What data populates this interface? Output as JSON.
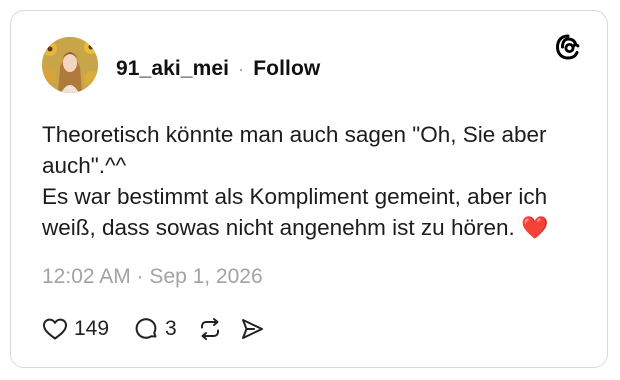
{
  "post": {
    "username": "91_aki_mei",
    "separator": "·",
    "follow_label": "Follow",
    "text_lines": [
      "Theoretisch könnte man auch sagen \"Oh, Sie aber",
      "auch\".^^",
      "Es war bestimmt als Kompliment gemeint, aber ich",
      "weiß, dass sowas nicht angenehm ist zu hören."
    ],
    "emoji": "❤️",
    "timestamp": "12:02 AM · Sep 1, 2026",
    "likes": "149",
    "replies": "3"
  },
  "icons": {
    "brand": "threads-logo-icon",
    "like": "heart-icon",
    "reply": "comment-icon",
    "repost": "repost-icon",
    "share": "send-icon"
  },
  "colors": {
    "text": "#1c1c1c",
    "muted": "#a3a3a3",
    "heart": "#e02424"
  }
}
